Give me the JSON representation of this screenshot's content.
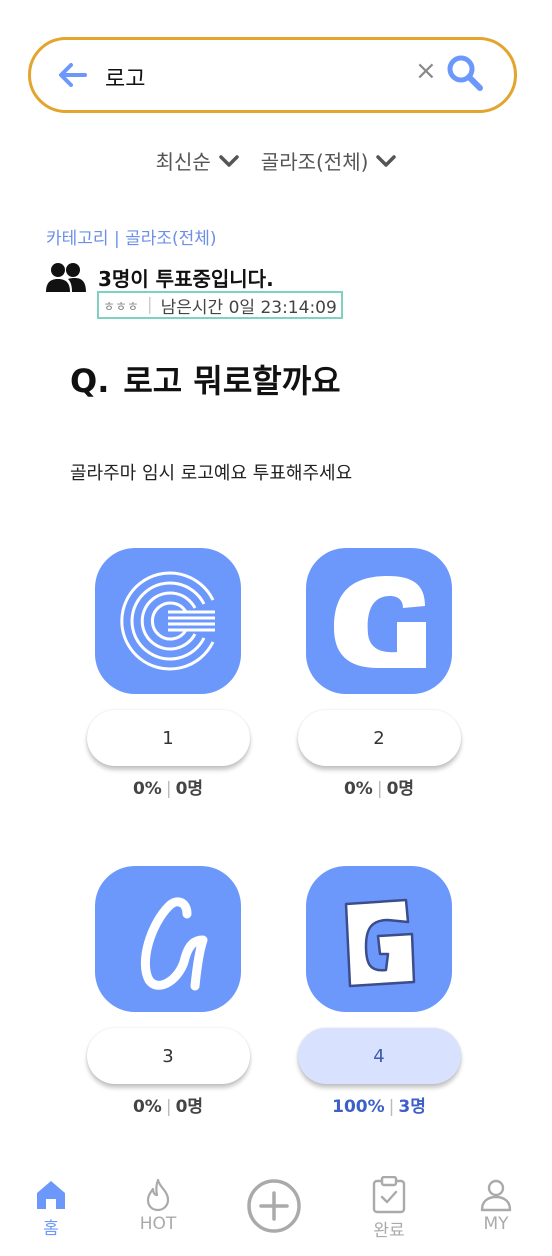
{
  "search": {
    "query": "로고",
    "clear_label": "×"
  },
  "filters": [
    {
      "label": "최신순"
    },
    {
      "label": "골라조(전체)"
    }
  ],
  "category": "카테고리 | 골라조(전체)",
  "voters": {
    "count_text": "3명이 투표중입니다."
  },
  "meta": {
    "author": "ㅎㅎㅎ",
    "separator": "|",
    "remaining": "남은시간 0일 23:14:09"
  },
  "question": {
    "prefix": "Q.",
    "title": "로고 뭐로할까요"
  },
  "description": "골라주마 임시 로고예요 투표해주세요",
  "options": [
    {
      "label": "1",
      "percent": "0%",
      "votes": "0명",
      "selected": false
    },
    {
      "label": "2",
      "percent": "0%",
      "votes": "0명",
      "selected": false
    },
    {
      "label": "3",
      "percent": "0%",
      "votes": "0명",
      "selected": false
    },
    {
      "label": "4",
      "percent": "100%",
      "votes": "3명",
      "selected": true
    }
  ],
  "stat_separator": "|",
  "nav": [
    {
      "label": "홈",
      "icon": "home-icon",
      "active": true
    },
    {
      "label": "HOT",
      "icon": "flame-icon",
      "active": false
    },
    {
      "label": "",
      "icon": "plus-circle-icon",
      "active": false
    },
    {
      "label": "완료",
      "icon": "clipboard-check-icon",
      "active": false
    },
    {
      "label": "MY",
      "icon": "person-icon",
      "active": false
    }
  ],
  "colors": {
    "accent": "#6d98fb",
    "search_border": "#e3a52e",
    "meta_border": "#7fd1c2",
    "selected_bg": "#d8e2ff"
  }
}
